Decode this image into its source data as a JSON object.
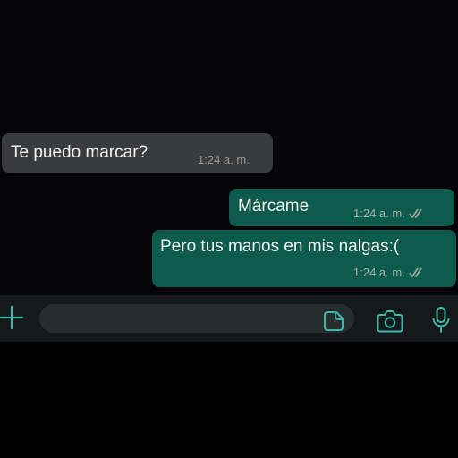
{
  "messages": [
    {
      "direction": "incoming",
      "text": "Te puedo marcar?",
      "time": "1:24 a. m."
    },
    {
      "direction": "outgoing",
      "text": "Márcame",
      "time": "1:24 a. m.",
      "status": "read"
    },
    {
      "direction": "outgoing",
      "text": "Pero tus manos en mis nalgas:(",
      "time": "1:24 a. m.",
      "status": "read"
    }
  ],
  "input_bar": {
    "placeholder": "",
    "icons": [
      "plus-icon",
      "sticker-icon",
      "camera-icon",
      "microphone-icon"
    ]
  },
  "colors": {
    "background": "#050406",
    "incoming_bubble": "#3a3b3d",
    "outgoing_bubble": "#0c5b4c",
    "accent": "#3fb6a6"
  }
}
